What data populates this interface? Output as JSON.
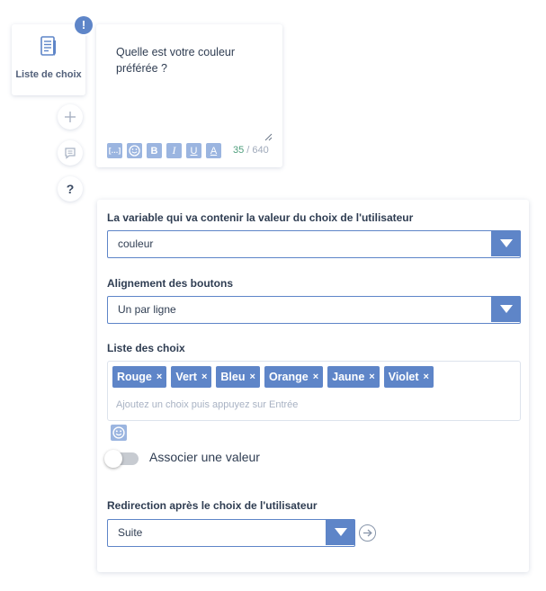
{
  "node": {
    "label": "Liste de choix",
    "icon": "list-document-icon",
    "badge": "!"
  },
  "side_buttons": [
    {
      "name": "add-block-button",
      "icon": "plus-icon"
    },
    {
      "name": "add-message-button",
      "icon": "chat-bubble-icon"
    },
    {
      "name": "help-button",
      "icon": "question-mark-icon",
      "glyph": "?"
    }
  ],
  "message": {
    "text": "Quelle est votre couleur préférée ?",
    "formatting": [
      {
        "name": "variable-button",
        "glyph": "[…]",
        "icon": "variable-brackets-icon"
      },
      {
        "name": "emoji-button",
        "glyph": "",
        "icon": "smiley-icon"
      },
      {
        "name": "bold-button",
        "glyph": "B",
        "icon": "bold-icon"
      },
      {
        "name": "italic-button",
        "glyph": "I",
        "icon": "italic-icon"
      },
      {
        "name": "underline-button",
        "glyph": "U",
        "icon": "underline-icon"
      },
      {
        "name": "text-color-button",
        "glyph": "A",
        "icon": "text-color-icon"
      }
    ],
    "char_count": "35",
    "char_sep": " / ",
    "char_max": "640"
  },
  "settings": {
    "variable_label": "La variable qui va contenir la valeur du choix de l'utilisateur",
    "variable_value": "couleur",
    "alignment_label": "Alignement des boutons",
    "alignment_value": "Un par ligne",
    "choices_label": "Liste des choix",
    "choices": [
      {
        "label": "Rouge",
        "remove": "×"
      },
      {
        "label": "Vert",
        "remove": "×"
      },
      {
        "label": "Bleu",
        "remove": "×"
      },
      {
        "label": "Orange",
        "remove": "×"
      },
      {
        "label": "Jaune",
        "remove": "×"
      },
      {
        "label": "Violet",
        "remove": "×"
      }
    ],
    "choices_placeholder": "Ajoutez un choix puis appuyez sur Entrée",
    "associate_label": "Associer une valeur",
    "associate_enabled": false,
    "redirect_label": "Redirection après le choix de l'utilisateur",
    "redirect_value": "Suite"
  },
  "colors": {
    "accent": "#5e85c8",
    "accent_light": "#9bb5e0",
    "counter_current": "#4e9e7c"
  }
}
